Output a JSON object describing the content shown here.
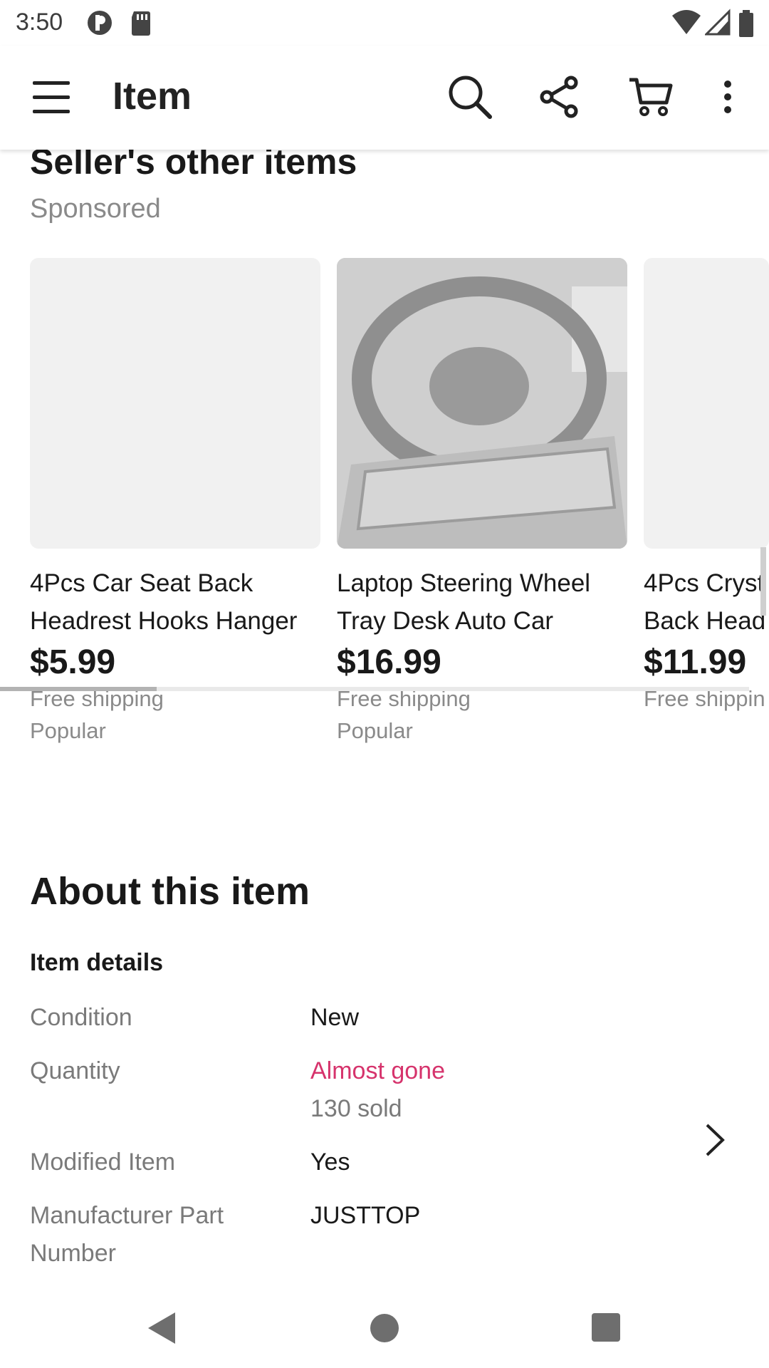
{
  "status_bar": {
    "time": "3:50"
  },
  "app_bar": {
    "title": "Item"
  },
  "seller_section": {
    "title": "Seller's other items",
    "subtitle": "Sponsored",
    "cards": [
      {
        "title_line1": "4Pcs Car Seat Back",
        "title_line2": "Headrest Hooks Hanger",
        "price": "$5.99",
        "shipping": "Free shipping",
        "tag": "Popular"
      },
      {
        "title_line1": "Laptop Steering Wheel",
        "title_line2": "Tray Desk Auto Car",
        "price": "$16.99",
        "shipping": "Free shipping",
        "tag": "Popular"
      },
      {
        "title_line1": "4Pcs Cryst",
        "title_line2": "Back Head",
        "price": "$11.99",
        "shipping": "Free shippin",
        "tag": ""
      }
    ],
    "scroll_position": 0.21
  },
  "about": {
    "title": "About this item",
    "details_heading": "Item details",
    "condition_label": "Condition",
    "condition_value": "New",
    "quantity_label": "Quantity",
    "quantity_value": "Almost gone",
    "quantity_sold": "130 sold",
    "modified_label": "Modified Item",
    "modified_value": "Yes",
    "mpn_label_line1": "Manufacturer Part",
    "mpn_label_line2": "Number",
    "mpn_value": "JUSTTOP"
  },
  "colors": {
    "alert": "#d6336c",
    "muted": "#7a7a7a",
    "text": "#191919"
  }
}
